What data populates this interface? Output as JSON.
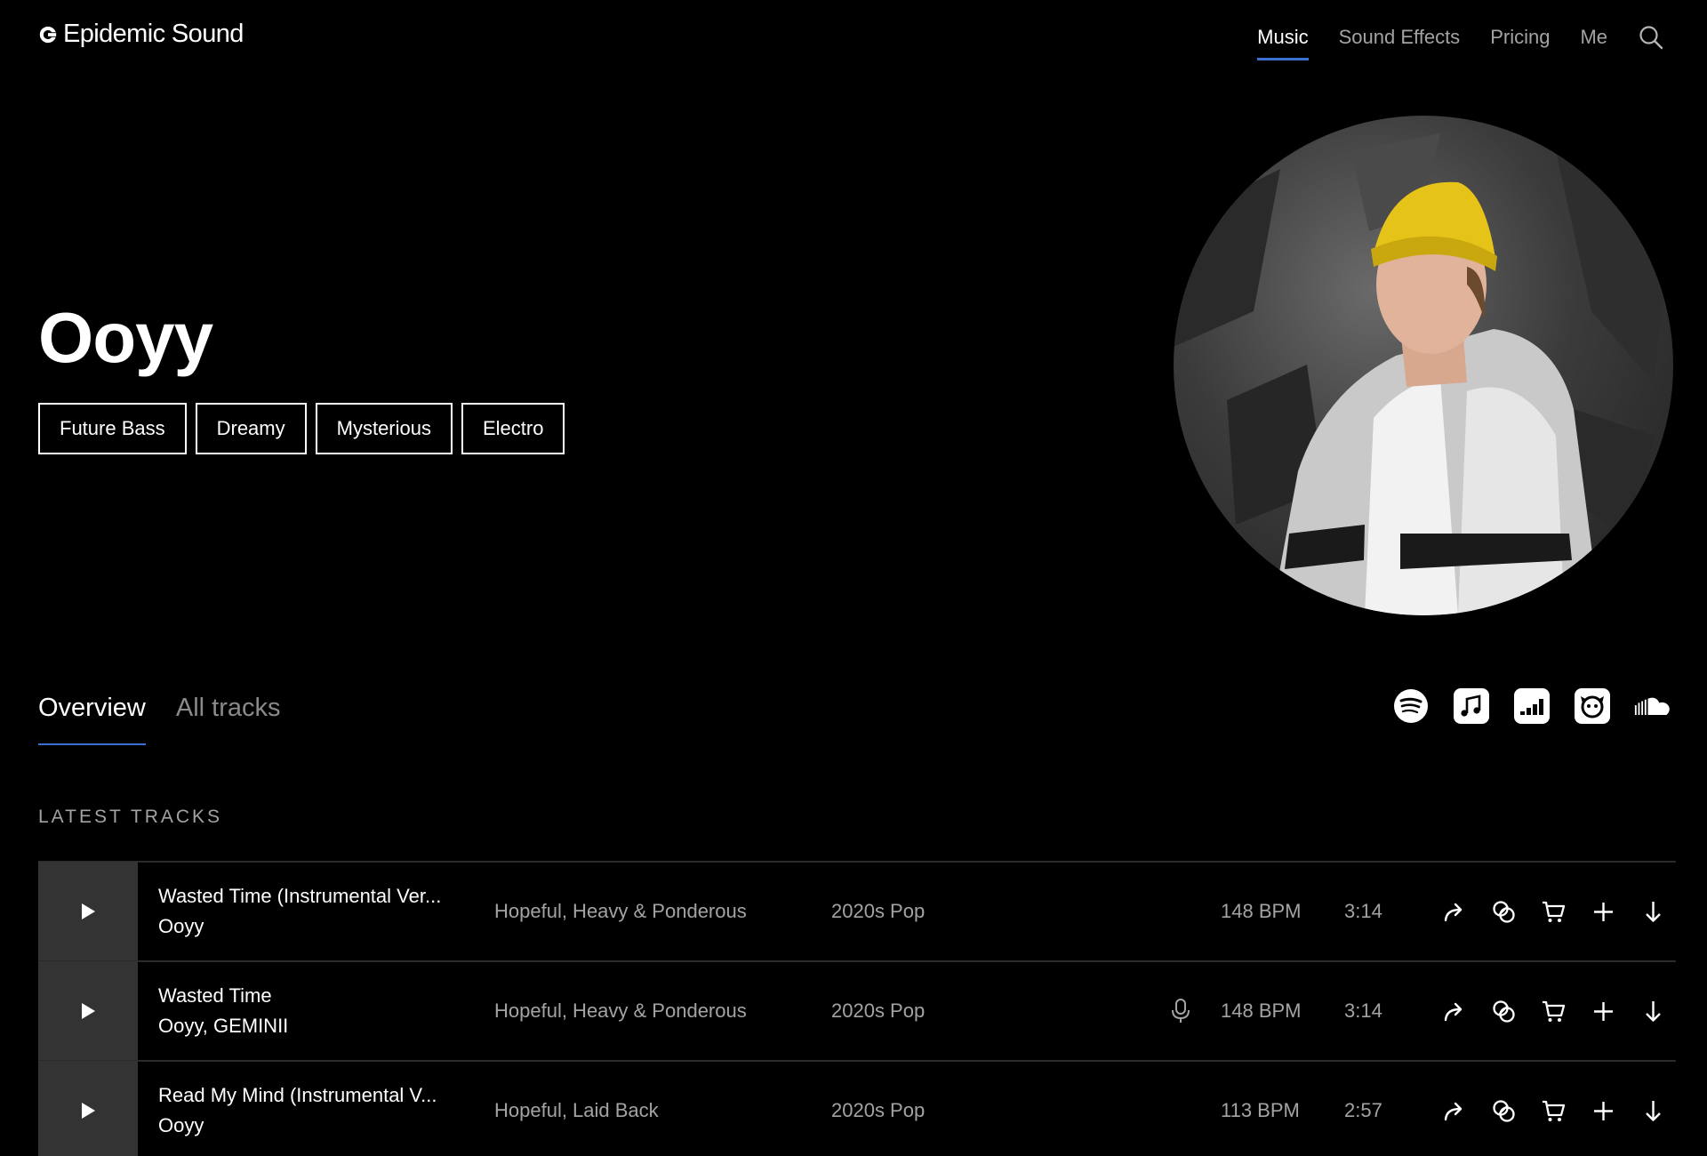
{
  "brand": {
    "name": "Epidemic Sound"
  },
  "nav": {
    "items": [
      {
        "label": "Music",
        "active": true
      },
      {
        "label": "Sound Effects",
        "active": false
      },
      {
        "label": "Pricing",
        "active": false
      },
      {
        "label": "Me",
        "active": false
      }
    ],
    "search_icon": "search-icon"
  },
  "artist": {
    "name": "Ooyy",
    "genres": [
      "Future Bass",
      "Dreamy",
      "Mysterious",
      "Electro"
    ],
    "portrait": "artist-portrait"
  },
  "tabs": [
    {
      "label": "Overview",
      "active": true
    },
    {
      "label": "All tracks",
      "active": false
    }
  ],
  "socials": [
    "spotify-icon",
    "apple-music-icon",
    "deezer-icon",
    "napster-icon",
    "soundcloud-icon"
  ],
  "latest": {
    "title": "LATEST TRACKS",
    "tracks": [
      {
        "title": "Wasted Time (Instrumental Ver...",
        "artists": [
          "Ooyy"
        ],
        "mood": "Hopeful, Heavy & Ponderous",
        "genre": "2020s Pop",
        "vocals": false,
        "bpm": "148 BPM",
        "duration": "3:14"
      },
      {
        "title": "Wasted Time",
        "artists": [
          "Ooyy",
          "GEMINII"
        ],
        "mood": "Hopeful, Heavy & Ponderous",
        "genre": "2020s Pop",
        "vocals": true,
        "bpm": "148 BPM",
        "duration": "3:14"
      },
      {
        "title": "Read My Mind (Instrumental V...",
        "artists": [
          "Ooyy"
        ],
        "mood": "Hopeful, Laid Back",
        "genre": "2020s Pop",
        "vocals": false,
        "bpm": "113 BPM",
        "duration": "2:57"
      }
    ]
  },
  "colors": {
    "accent": "#3b6fd1",
    "background": "#000000",
    "muted_text": "#a3a3a3",
    "play_cell": "#333333"
  }
}
